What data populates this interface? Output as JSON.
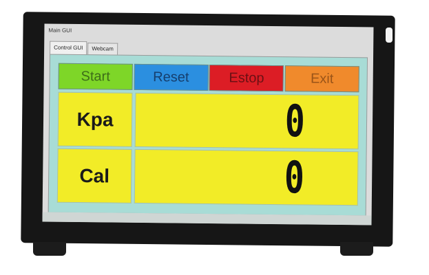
{
  "window": {
    "title": "Main GUI"
  },
  "tabs": [
    {
      "label": "Control GUI",
      "active": true
    },
    {
      "label": "Webcam",
      "active": false
    }
  ],
  "buttons": {
    "start": {
      "label": "Start",
      "color": "#7ed628"
    },
    "reset": {
      "label": "Reset",
      "color": "#2b8fe0"
    },
    "estop": {
      "label": "Estop",
      "color": "#dc1d25"
    },
    "exit": {
      "label": "Exit",
      "color": "#f08a2c"
    }
  },
  "readouts": [
    {
      "label": "Kpa",
      "value": "0"
    },
    {
      "label": "Cal",
      "value": "0"
    }
  ],
  "colors": {
    "panel_bg": "#a8dcd6",
    "readout_bg": "#f2ec27"
  }
}
